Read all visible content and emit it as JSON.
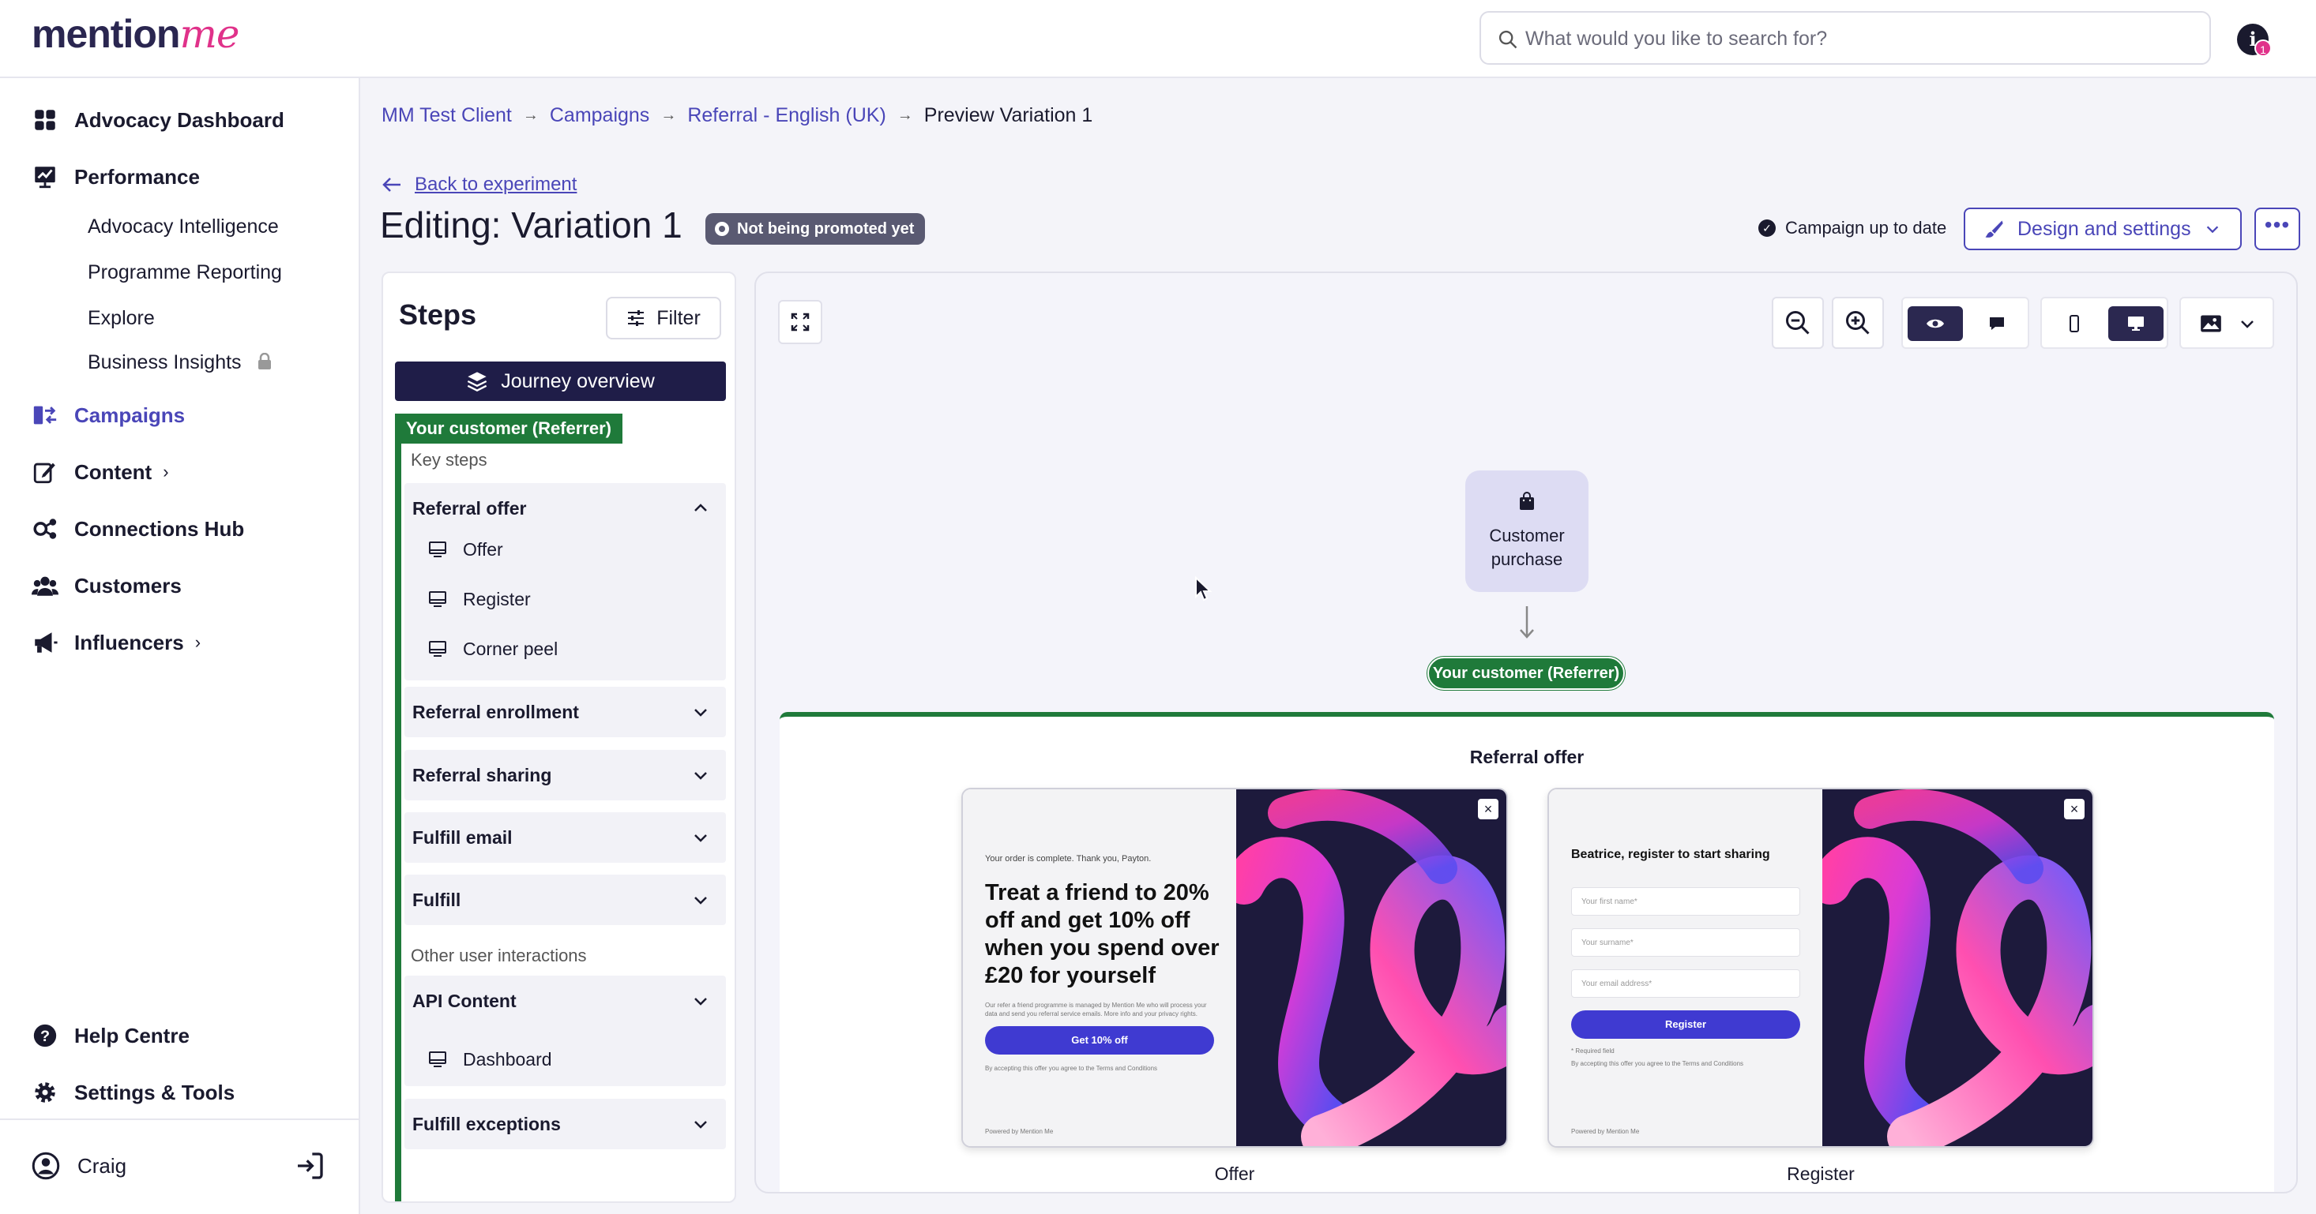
{
  "header": {
    "logo_main": "mention",
    "logo_accent": "me",
    "search_placeholder": "What would you like to search for?",
    "notification_count": "1",
    "info_glyph": "i"
  },
  "sidebar": {
    "items": [
      {
        "label": "Advocacy Dashboard",
        "icon": "dashboard-icon"
      },
      {
        "label": "Performance",
        "icon": "performance-icon"
      },
      {
        "label": "Campaigns",
        "icon": "campaigns-icon",
        "active": true
      },
      {
        "label": "Content",
        "icon": "edit-icon",
        "chevron": "›"
      },
      {
        "label": "Connections Hub",
        "icon": "connections-icon"
      },
      {
        "label": "Customers",
        "icon": "customers-icon"
      },
      {
        "label": "Influencers",
        "icon": "megaphone-icon",
        "chevron": "›"
      }
    ],
    "performance_children": [
      "Advocacy Intelligence",
      "Programme Reporting",
      "Explore",
      "Business Insights"
    ],
    "bottom_items": [
      {
        "label": "Help Centre",
        "icon": "help-icon"
      },
      {
        "label": "Settings & Tools",
        "icon": "gear-icon"
      }
    ],
    "user_name": "Craig"
  },
  "breadcrumb": {
    "items": [
      "MM Test Client",
      "Campaigns",
      "Referral - English (UK)"
    ],
    "current": "Preview Variation 1",
    "separator": "→"
  },
  "page": {
    "back_label": "Back to experiment",
    "title": "Editing: Variation 1",
    "status_badge": "Not being promoted yet",
    "campaign_status": "Campaign up to date",
    "design_button": "Design and settings",
    "more_button": "•••"
  },
  "steps": {
    "title": "Steps",
    "filter_label": "Filter",
    "journey_label": "Journey overview",
    "referrer_tag": "Your customer (Referrer)",
    "key_steps_label": "Key steps",
    "other_label": "Other user interactions",
    "groups": [
      {
        "label": "Referral offer",
        "expanded": true,
        "children": [
          "Offer",
          "Register",
          "Corner peel"
        ]
      },
      {
        "label": "Referral enrollment"
      },
      {
        "label": "Referral sharing"
      },
      {
        "label": "Fulfill email"
      },
      {
        "label": "Fulfill"
      },
      {
        "label": "API Content",
        "children": [
          "Dashboard"
        ]
      },
      {
        "label": "Fulfill exceptions"
      }
    ]
  },
  "canvas": {
    "purchase_node": "Customer purchase",
    "referrer_pill": "Your customer (Referrer)",
    "offer_section_title": "Referral offer",
    "offer_card": {
      "intro": "Your order is complete. Thank you, Payton.",
      "headline": "Treat a friend to 20% off and get 10% off when you spend over £20 for yourself",
      "fine_print": "Our refer a friend programme is managed by Mention Me who will process your data and send you referral service emails. More info and your privacy rights.",
      "cta": "Get 10% off",
      "terms": "By accepting this offer you agree to the Terms and Conditions",
      "powered": "Powered by Mention Me",
      "caption": "Offer"
    },
    "register_card": {
      "headline": "Beatrice, register to start sharing",
      "fields": [
        "Your first name*",
        "Your surname*",
        "Your email address*"
      ],
      "cta": "Register",
      "required_note": "* Required field",
      "terms": "By accepting this offer you agree to the Terms and Conditions",
      "powered": "Powered by Mention Me",
      "caption": "Register"
    },
    "close_glyph": "×"
  },
  "colors": {
    "brand": "#4a46b8",
    "accent": "#e0328a",
    "referrer_green": "#1f7a3a",
    "dark": "#1f1d48"
  }
}
